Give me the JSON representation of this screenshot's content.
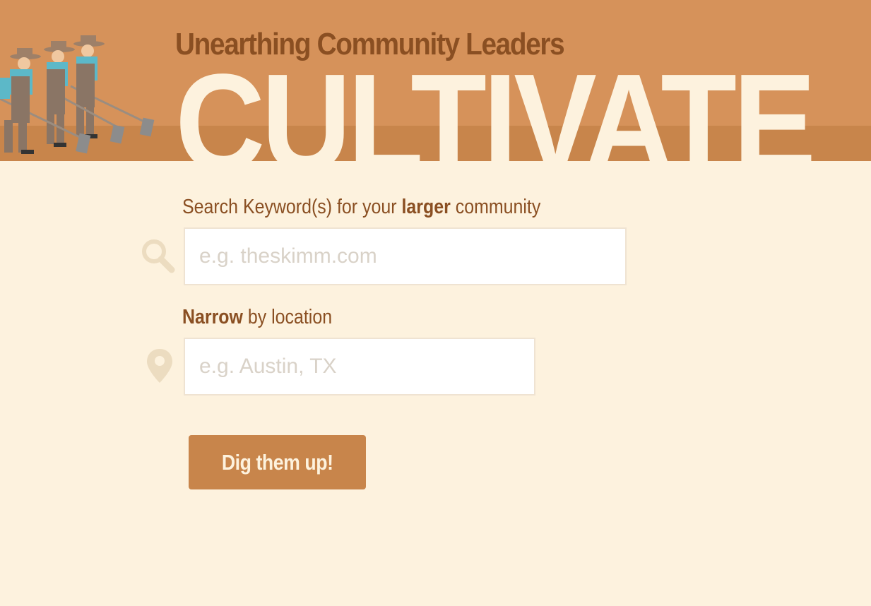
{
  "header": {
    "subtitle": "Unearthing Community Leaders",
    "title": "CULTIVATE"
  },
  "search": {
    "label_prefix": "Search Keyword(s) for your ",
    "label_emphasis": "larger",
    "label_suffix": " community",
    "placeholder": "e.g. theskimm.com",
    "value": ""
  },
  "location": {
    "label_emphasis": "Narrow",
    "label_suffix": " by location",
    "placeholder": "e.g. Austin, TX",
    "value": ""
  },
  "submit": {
    "label": "Dig them up!"
  },
  "icons": {
    "search": "search-icon",
    "location": "map-pin-icon",
    "illustration": "farmers-illustration"
  },
  "colors": {
    "background": "#fdf2de",
    "header": "#d6925a",
    "header_band": "#c8854b",
    "text_brown": "#8a4f22",
    "button": "#c8854b",
    "icon_tint": "#ecdcc0"
  }
}
